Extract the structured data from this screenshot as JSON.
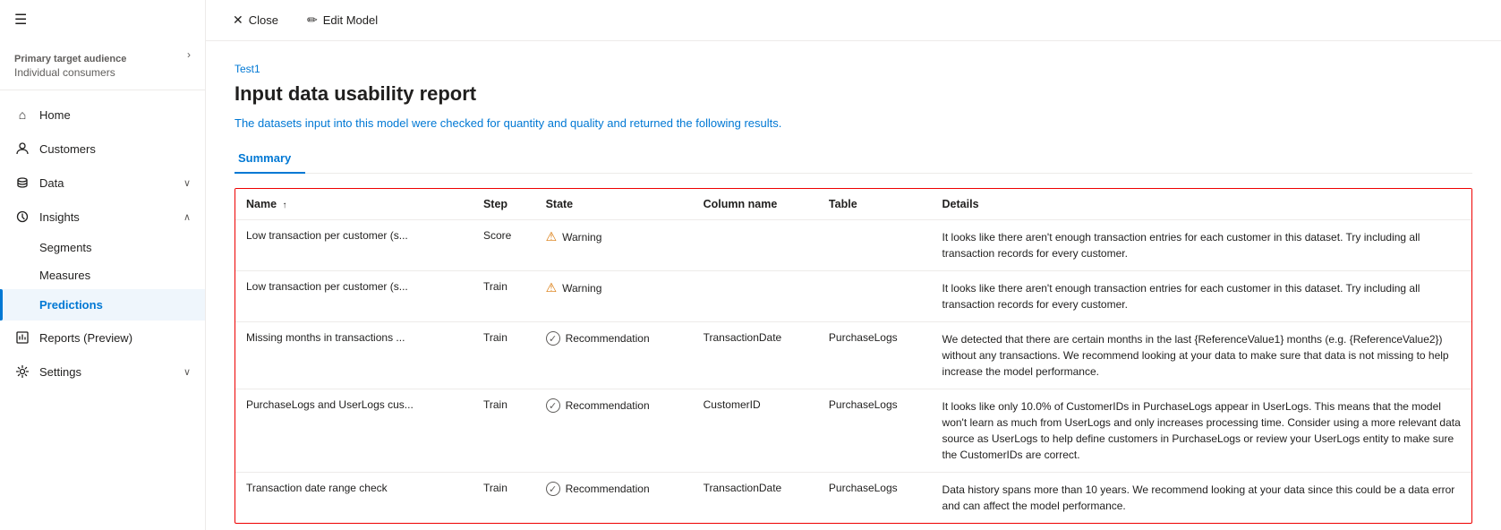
{
  "sidebar": {
    "hamburger": "☰",
    "header": {
      "primary_label": "Primary target audience",
      "secondary_label": "Individual consumers",
      "chevron": "›"
    },
    "items": [
      {
        "id": "home",
        "label": "Home",
        "icon": "⌂",
        "active": false,
        "expandable": false
      },
      {
        "id": "customers",
        "label": "Customers",
        "icon": "👤",
        "active": false,
        "expandable": false
      },
      {
        "id": "data",
        "label": "Data",
        "icon": "🗄",
        "active": false,
        "expandable": true,
        "expanded": false
      },
      {
        "id": "insights",
        "label": "Insights",
        "icon": "💡",
        "active": false,
        "expandable": true,
        "expanded": true
      },
      {
        "id": "segments",
        "label": "Segments",
        "sub": true
      },
      {
        "id": "measures",
        "label": "Measures",
        "sub": true
      },
      {
        "id": "predictions",
        "label": "Predictions",
        "active": true,
        "sub": false,
        "indent": false
      },
      {
        "id": "reports",
        "label": "Reports (Preview)",
        "icon": "📊",
        "active": false,
        "expandable": false
      },
      {
        "id": "settings",
        "label": "Settings",
        "icon": "⚙",
        "active": false,
        "expandable": true,
        "expanded": false
      }
    ]
  },
  "topbar": {
    "close_label": "Close",
    "edit_label": "Edit Model",
    "close_icon": "✕",
    "edit_icon": "✏"
  },
  "content": {
    "breadcrumb": "Test1",
    "title": "Input data usability report",
    "description": "The datasets input into this model were checked for quantity and quality and returned the following results.",
    "tab_label": "Summary",
    "table": {
      "columns": [
        {
          "id": "name",
          "label": "Name",
          "sortable": true
        },
        {
          "id": "step",
          "label": "Step"
        },
        {
          "id": "state",
          "label": "State"
        },
        {
          "id": "column_name",
          "label": "Column name"
        },
        {
          "id": "table",
          "label": "Table"
        },
        {
          "id": "details",
          "label": "Details"
        }
      ],
      "rows": [
        {
          "name": "Low transaction per customer (s...",
          "step": "Score",
          "state": "Warning",
          "state_type": "warning",
          "column_name": "",
          "table": "",
          "details": "It looks like there aren't enough transaction entries for each customer in this dataset. Try including all transaction records for every customer."
        },
        {
          "name": "Low transaction per customer (s...",
          "step": "Train",
          "state": "Warning",
          "state_type": "warning",
          "column_name": "",
          "table": "",
          "details": "It looks like there aren't enough transaction entries for each customer in this dataset. Try including all transaction records for every customer."
        },
        {
          "name": "Missing months in transactions ...",
          "step": "Train",
          "state": "Recommendation",
          "state_type": "recommendation",
          "column_name": "TransactionDate",
          "table": "PurchaseLogs",
          "details": "We detected that there are certain months in the last {ReferenceValue1} months (e.g. {ReferenceValue2}) without any transactions. We recommend looking at your data to make sure that data is not missing to help increase the model performance."
        },
        {
          "name": "PurchaseLogs and UserLogs cus...",
          "step": "Train",
          "state": "Recommendation",
          "state_type": "recommendation",
          "column_name": "CustomerID",
          "table": "PurchaseLogs",
          "details": "It looks like only 10.0% of CustomerIDs in PurchaseLogs appear in UserLogs. This means that the model won't learn as much from UserLogs and only increases processing time. Consider using a more relevant data source as UserLogs to help define customers in PurchaseLogs or review your UserLogs entity to make sure the CustomerIDs are correct."
        },
        {
          "name": "Transaction date range check",
          "step": "Train",
          "state": "Recommendation",
          "state_type": "recommendation",
          "column_name": "TransactionDate",
          "table": "PurchaseLogs",
          "details": "Data history spans more than 10 years. We recommend looking at your data since this could be a data error and can affect the model performance."
        }
      ]
    }
  }
}
